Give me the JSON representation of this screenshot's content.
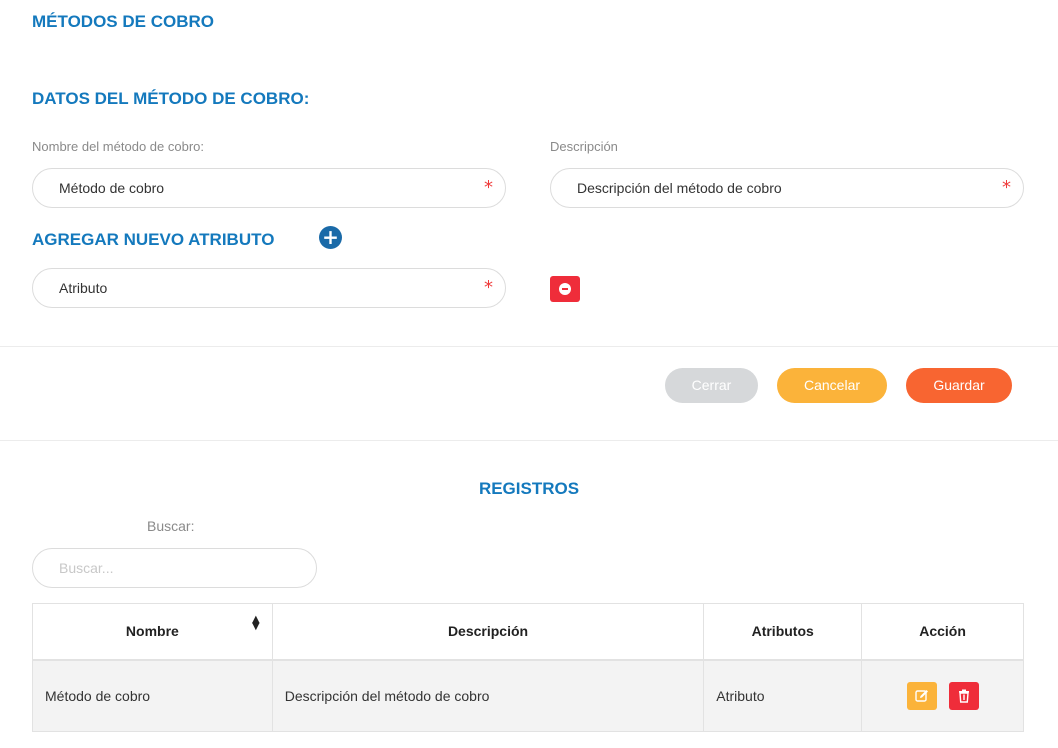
{
  "page": {
    "title": "MÉTODOS DE COBRO"
  },
  "form": {
    "section_title": "DATOS DEL MÉTODO DE COBRO:",
    "name_label": "Nombre del método de cobro:",
    "name_value": "Método de cobro",
    "desc_label": "Descripción",
    "desc_value": "Descripción del método de cobro",
    "required_mark": "*",
    "add_attribute_title": "AGREGAR NUEVO ATRIBUTO",
    "add_icon": "plus-circle-icon",
    "attribute_value": "Atributo",
    "remove_icon": "minus-circle-icon"
  },
  "actions": {
    "close_label": "Cerrar",
    "cancel_label": "Cancelar",
    "save_label": "Guardar"
  },
  "records": {
    "title": "REGISTROS",
    "search_label": "Buscar:",
    "search_placeholder": "Buscar...",
    "columns": [
      "Nombre",
      "Descripción",
      "Atributos",
      "Acción"
    ],
    "rows": [
      {
        "nombre": "Método de cobro",
        "descripcion": "Descripción del método de cobro",
        "atributos": "Atributo"
      }
    ]
  },
  "colors": {
    "heading": "#1479bd",
    "cerrar": "#d6d8da",
    "cancelar": "#fbb33a",
    "guardar": "#f86531",
    "danger": "#ef2d3a"
  }
}
